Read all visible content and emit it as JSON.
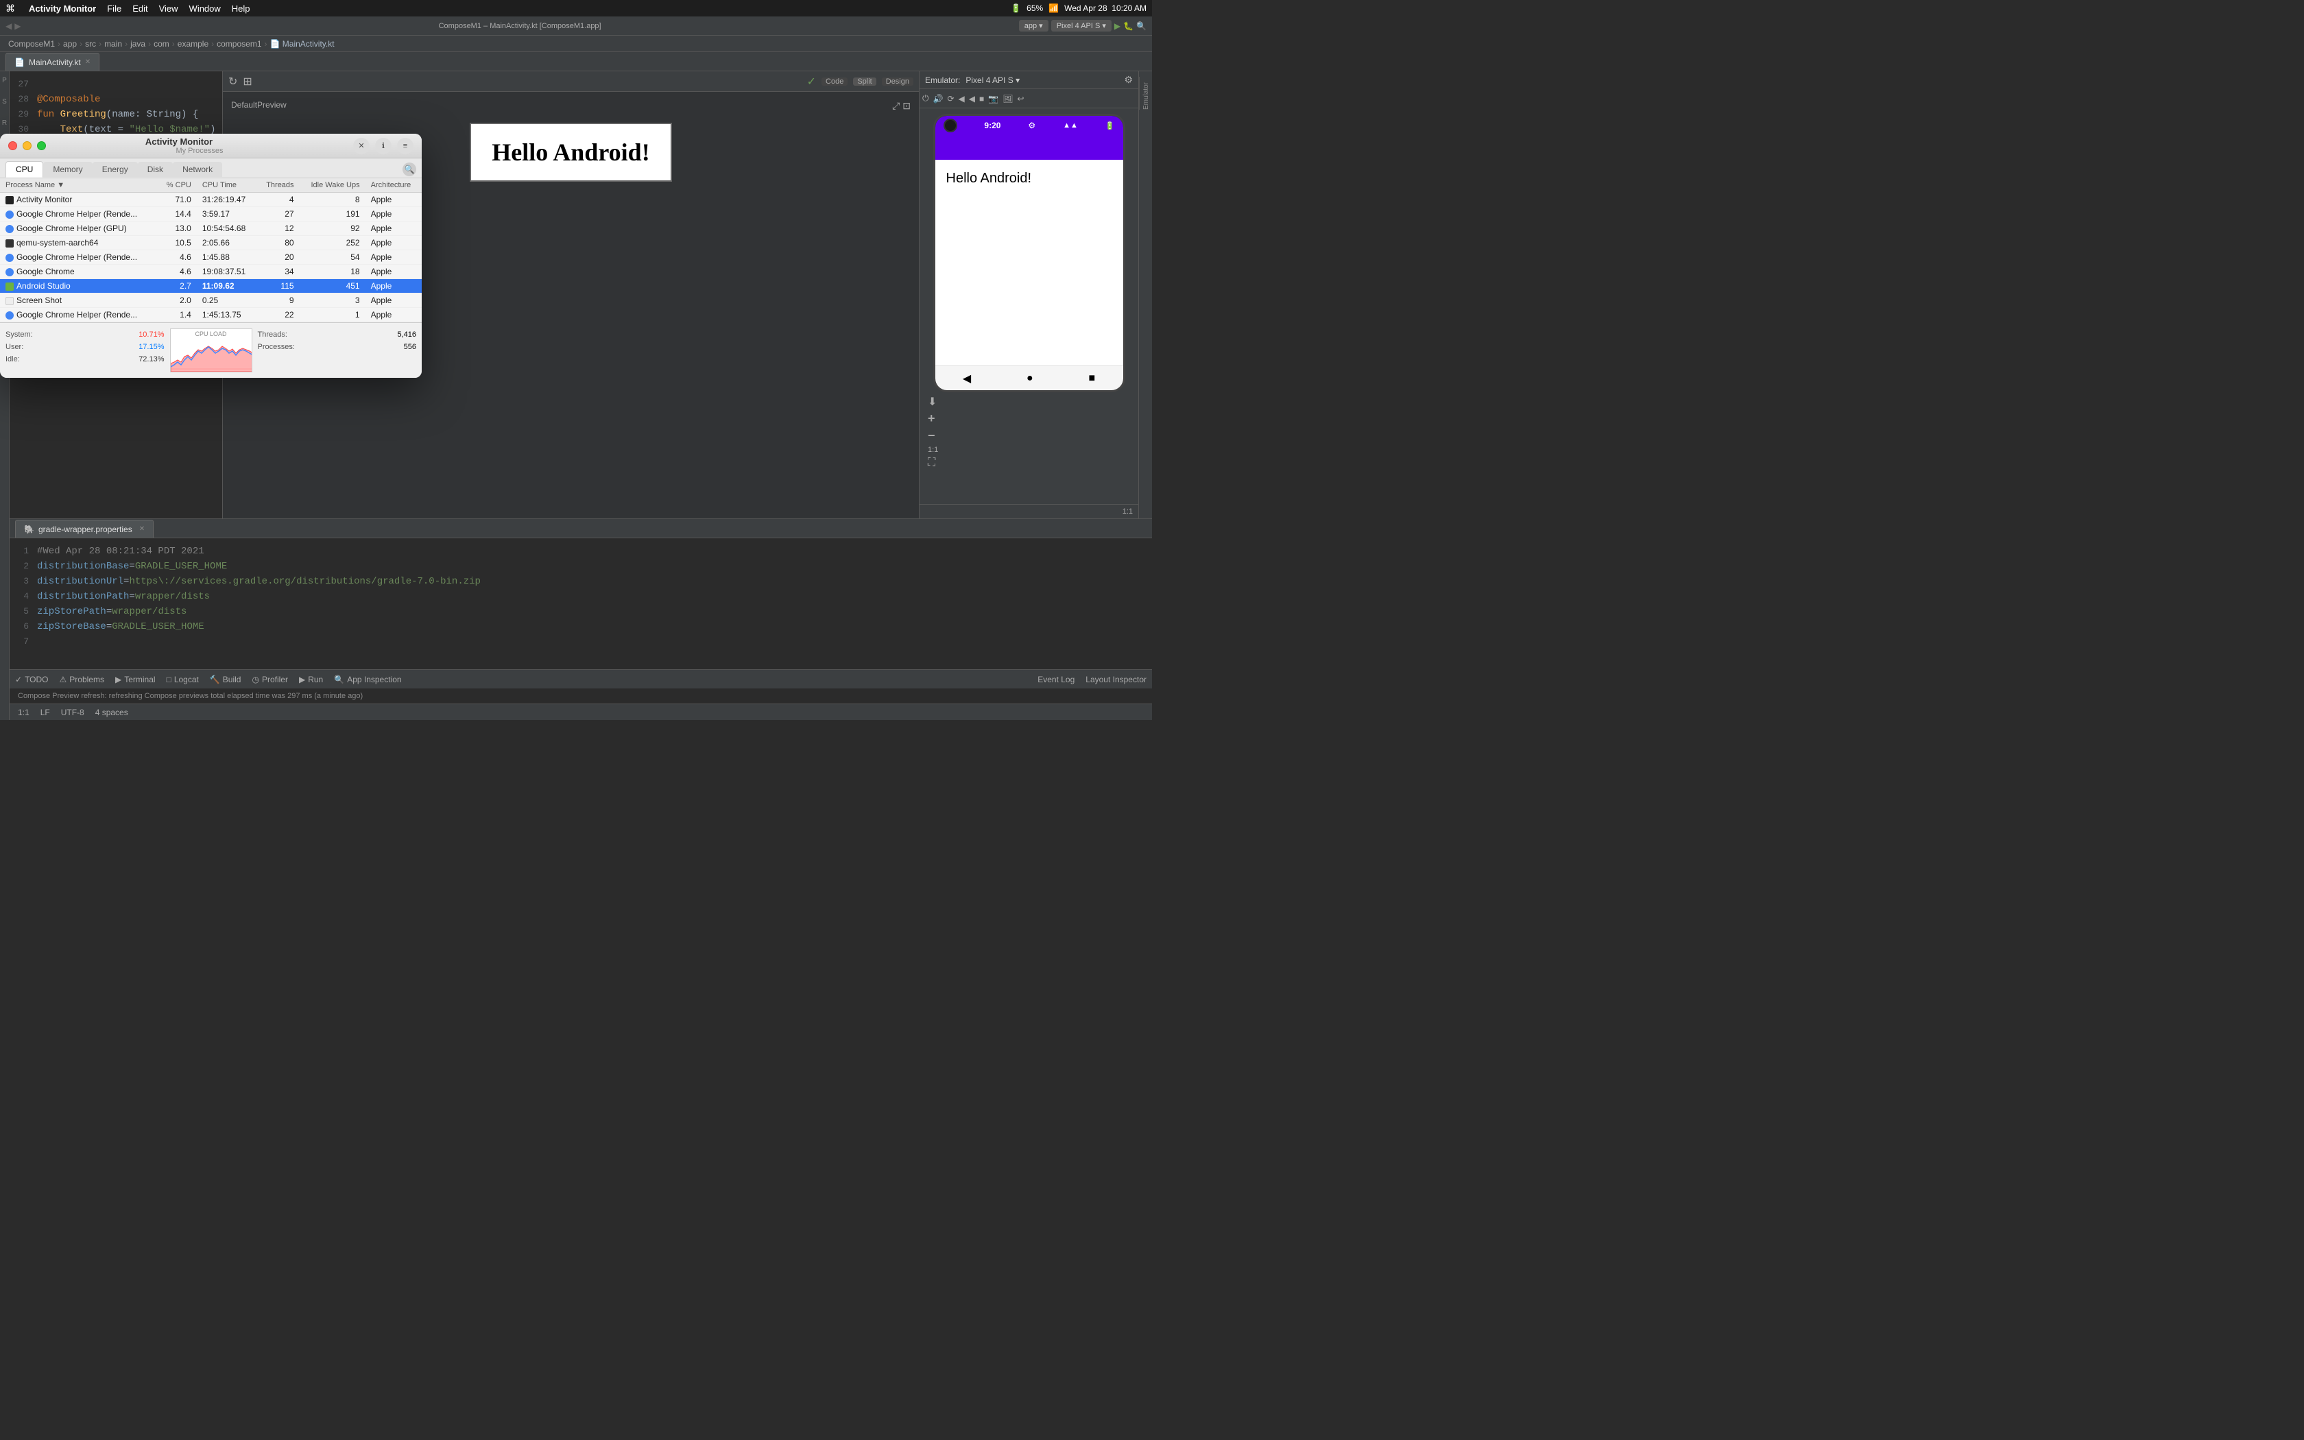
{
  "menubar": {
    "apple": "⌘",
    "app_name": "Activity Monitor",
    "menu_items": [
      "File",
      "Edit",
      "View",
      "Window",
      "Help"
    ],
    "right_items": [
      "65%",
      "Wed Apr 28",
      "10:20 AM"
    ]
  },
  "ide": {
    "title": "ComposeM1 – MainActivity.kt [ComposeM1.app]",
    "toolbar_items": [
      "app ▾",
      "Pixel 4 API S ▾"
    ],
    "breadcrumb": [
      "ComposeM1",
      "app",
      "src",
      "main",
      "java",
      "com",
      "example",
      "composem1",
      "MainActivity.kt"
    ],
    "tabs": [
      {
        "label": "MainActivity.kt",
        "active": true
      },
      {
        "label": "gradle-wrapper.properties",
        "active": false
      }
    ],
    "code_lines": [
      {
        "num": "27",
        "content": ""
      },
      {
        "num": "28",
        "content": "@Composable"
      },
      {
        "num": "29",
        "content": "fun Greeting(name: String) {"
      },
      {
        "num": "30",
        "content": "    Text(text = \"Hello $name!\")"
      }
    ],
    "gradle_lines": [
      {
        "num": "1",
        "content": "#Wed Apr 28 08:21:34 PDT 2021"
      },
      {
        "num": "2",
        "content": "distributionBase=GRADLE_USER_HOME"
      },
      {
        "num": "3",
        "content": "distributionUrl=https\\://services.gradle.org/distributions/gradle-7.0-bin.zip"
      },
      {
        "num": "4",
        "content": "distributionPath=wrapper/dists"
      },
      {
        "num": "5",
        "content": "zipStorePath=wrapper/dists"
      },
      {
        "num": "6",
        "content": "zipStoreBase=GRADLE_USER_HOME"
      },
      {
        "num": "7",
        "content": ""
      }
    ],
    "preview": {
      "label": "DefaultPreview",
      "hello_text": "Hello Android!"
    },
    "emulator": {
      "title": "Emulator:",
      "device": "Pixel 4 API S",
      "time": "9:20",
      "hello_text": "Hello Android!"
    },
    "bottom_tabs": [
      {
        "icon": "✓",
        "label": "TODO"
      },
      {
        "icon": "⚠",
        "label": "Problems"
      },
      {
        "icon": "▶",
        "label": "Terminal"
      },
      {
        "icon": "□",
        "label": "Logcat"
      },
      {
        "icon": "🔨",
        "label": "Build"
      },
      {
        "icon": "◷",
        "label": "Profiler"
      },
      {
        "icon": "▶",
        "label": "Run"
      },
      {
        "icon": "🔍",
        "label": "App Inspection"
      }
    ],
    "bottom_right_tabs": [
      "Event Log",
      "Layout Inspector"
    ],
    "status": {
      "line_col": "1:1",
      "lf": "LF",
      "encoding": "UTF-8",
      "indent": "4 spaces"
    },
    "compose_status": "Compose Preview refresh: refreshing Compose previews total elapsed time was 297 ms (a minute ago)"
  },
  "activity_monitor": {
    "title": "Activity Monitor",
    "subtitle": "My Processes",
    "tabs": [
      {
        "label": "CPU",
        "active": true
      },
      {
        "label": "Memory",
        "active": false
      },
      {
        "label": "Energy",
        "active": false
      },
      {
        "label": "Disk",
        "active": false
      },
      {
        "label": "Network",
        "active": false
      }
    ],
    "columns": [
      "Process Name",
      "% CPU",
      "CPU Time",
      "Threads",
      "Idle Wake Ups",
      "Architecture"
    ],
    "processes": [
      {
        "icon": "black",
        "name": "Activity Monitor",
        "cpu": "71.0",
        "cpu_time": "31:26:19.47",
        "threads": "4",
        "idle": "8",
        "arch": "Apple",
        "selected": false
      },
      {
        "icon": "chrome",
        "name": "Google Chrome Helper (Rende...",
        "cpu": "14.4",
        "cpu_time": "3:59.17",
        "threads": "27",
        "idle": "191",
        "arch": "Apple",
        "selected": false
      },
      {
        "icon": "chrome",
        "name": "Google Chrome Helper (GPU)",
        "cpu": "13.0",
        "cpu_time": "10:54:54.68",
        "threads": "12",
        "idle": "92",
        "arch": "Apple",
        "selected": false
      },
      {
        "icon": "black",
        "name": "qemu-system-aarch64",
        "cpu": "10.5",
        "cpu_time": "2:05.66",
        "threads": "80",
        "idle": "252",
        "arch": "Apple",
        "selected": false
      },
      {
        "icon": "chrome",
        "name": "Google Chrome Helper (Rende...",
        "cpu": "4.6",
        "cpu_time": "1:45.88",
        "threads": "20",
        "idle": "54",
        "arch": "Apple",
        "selected": false
      },
      {
        "icon": "chrome",
        "name": "Google Chrome",
        "cpu": "4.6",
        "cpu_time": "19:08:37.51",
        "threads": "34",
        "idle": "18",
        "arch": "Apple",
        "selected": false
      },
      {
        "icon": "android",
        "name": "Android Studio",
        "cpu": "2.7",
        "cpu_time": "11:09.62",
        "threads": "115",
        "idle": "451",
        "arch": "Apple",
        "selected": true
      },
      {
        "icon": "none",
        "name": "Screen Shot",
        "cpu": "2.0",
        "cpu_time": "0.25",
        "threads": "9",
        "idle": "3",
        "arch": "Apple",
        "selected": false
      },
      {
        "icon": "chrome",
        "name": "Google Chrome Helper (Rende...",
        "cpu": "1.4",
        "cpu_time": "1:45:13.75",
        "threads": "22",
        "idle": "1",
        "arch": "Apple",
        "selected": false
      }
    ],
    "stats": {
      "system_label": "System:",
      "system_value": "10.71%",
      "user_label": "User:",
      "user_value": "17.15%",
      "idle_label": "Idle:",
      "idle_value": "72.13%",
      "threads_label": "Threads:",
      "threads_value": "5,416",
      "processes_label": "Processes:",
      "processes_value": "556",
      "graph_title": "CPU LOAD"
    }
  }
}
